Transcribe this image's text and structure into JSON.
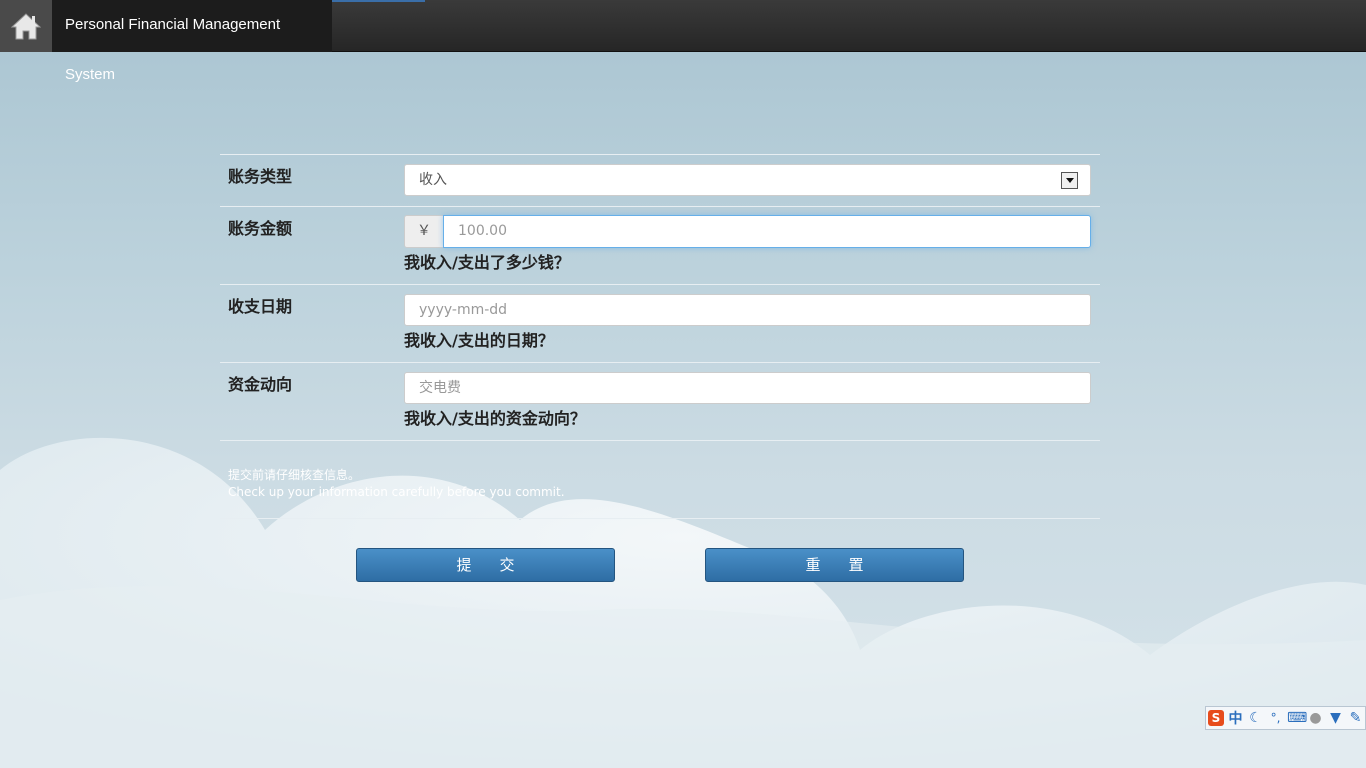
{
  "app": {
    "title": "Personal Financial Management System",
    "home_icon": "home-icon"
  },
  "form": {
    "type_label": "账务类型",
    "type_value": "收入",
    "amount_label": "账务金额",
    "currency_symbol": "￥",
    "amount_placeholder": "100.00",
    "amount_help": "我收入/支出了多少钱？",
    "date_label": "收支日期",
    "date_placeholder": "yyyy-mm-dd",
    "date_help": "我收入/支出的日期？",
    "flow_label": "资金动向",
    "flow_placeholder": "交电费",
    "flow_help": "我收入/支出的资金动向？",
    "note_cn": "提交前请仔细核查信息。",
    "note_en": "Check up your information carefully before you commit."
  },
  "buttons": {
    "submit": "提交",
    "reset": "重置"
  },
  "ime_toolbar": {
    "mode": "中",
    "punct": "°,",
    "icons": [
      "sogou-logo-icon",
      "moon-icon",
      "keyboard-icon",
      "user-icon",
      "shirt-icon",
      "wrench-icon"
    ]
  },
  "colors": {
    "navbar": "#262626",
    "button": "#337ab7",
    "focus": "#66afe9"
  }
}
